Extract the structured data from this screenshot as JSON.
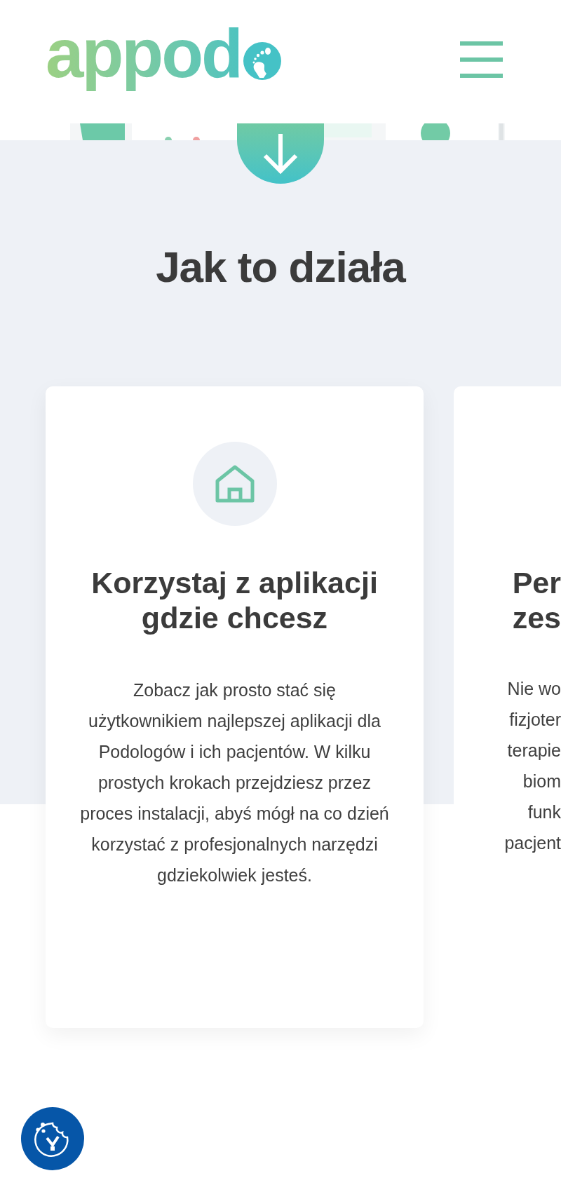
{
  "header": {
    "logo_text": "appod"
  },
  "section": {
    "title": "Jak to działa"
  },
  "cards": [
    {
      "kind": "full",
      "title": "Korzystaj z aplikacji gdzie chcesz",
      "body": "Zobacz jak prosto stać się użytkownikiem najlepszej aplikacji dla Podologów i ich pacjentów. W kilku prostych krokach przejdziesz przez proces instalacji, abyś mógł na co dzień korzystać z profesjonalnych narzędzi gdziekolwiek jesteś."
    },
    {
      "kind": "cut",
      "title_lines": [
        "Per",
        "zes"
      ],
      "body_lines": [
        "Nie wo",
        "fizjoter",
        "terapie",
        "biom",
        "funk",
        "pacjent"
      ]
    }
  ]
}
